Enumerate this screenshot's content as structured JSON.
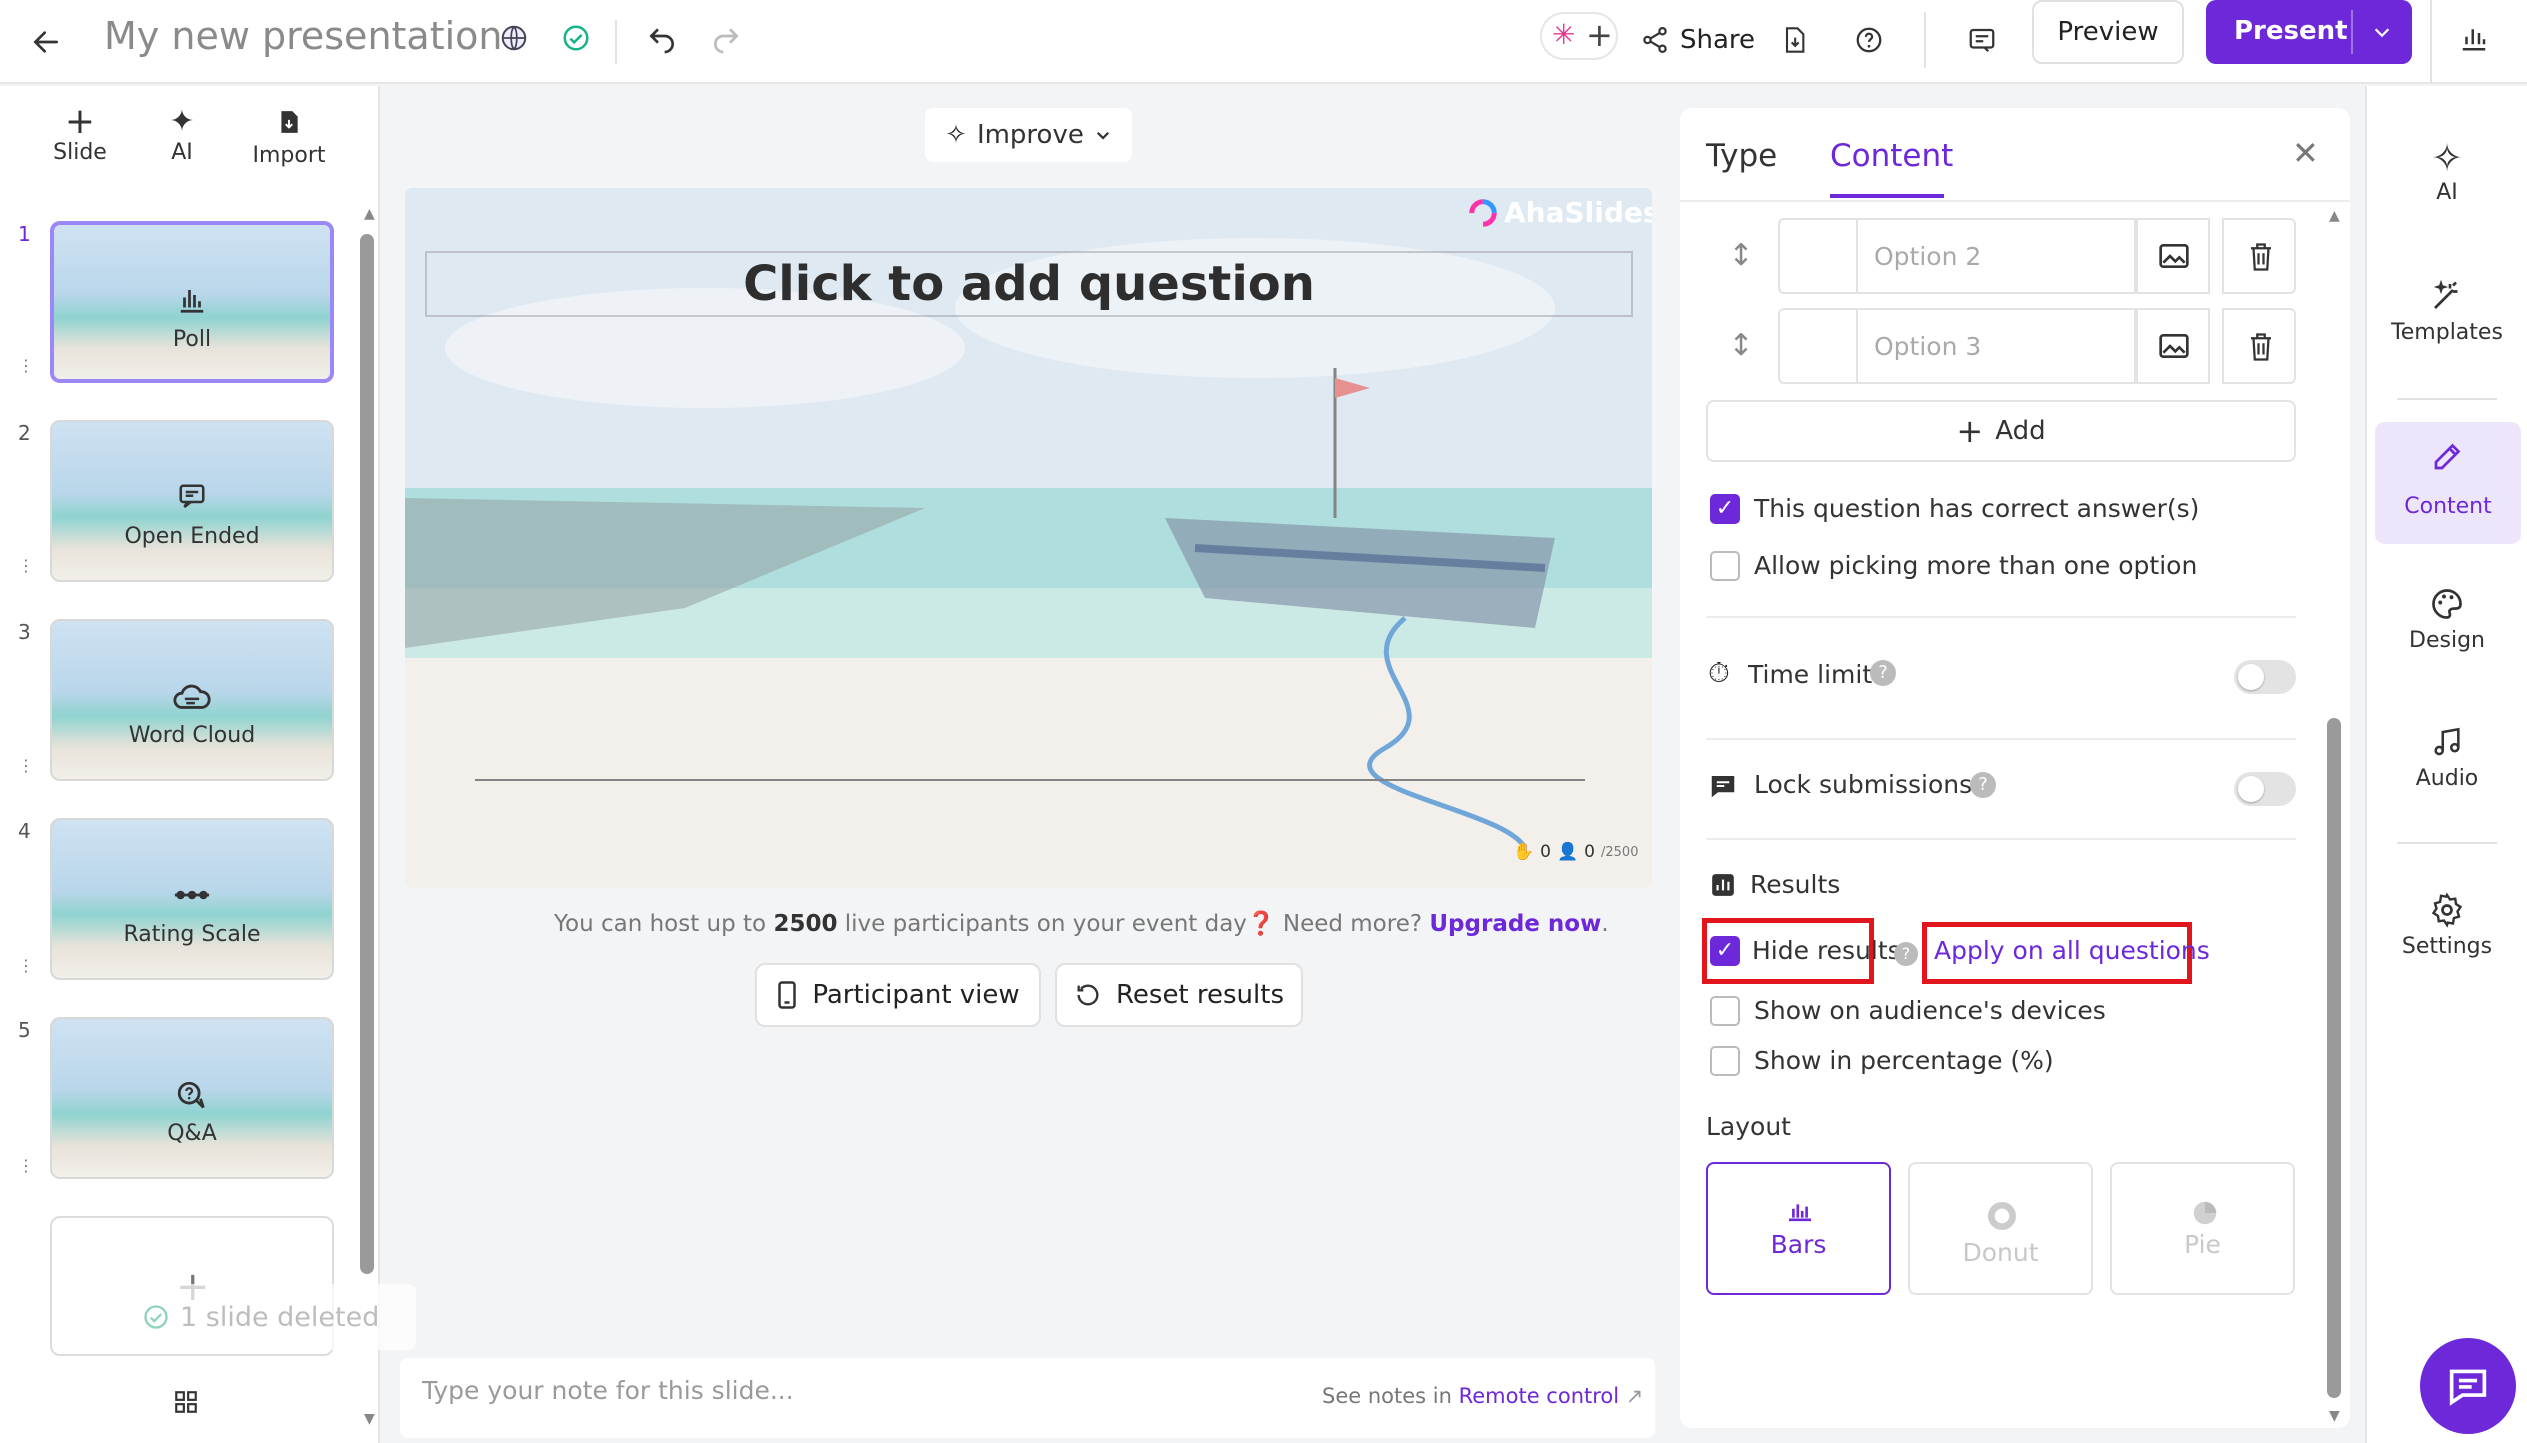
{
  "topbar": {
    "title": "My new presentation",
    "share_label": "Share",
    "preview_label": "Preview",
    "present_label": "Present"
  },
  "left_tools": [
    {
      "label": "Slide",
      "icon": "plus-icon"
    },
    {
      "label": "AI",
      "icon": "sparkle-icon"
    },
    {
      "label": "Import",
      "icon": "file-import-icon"
    }
  ],
  "slides": [
    {
      "num": "1",
      "label": "Poll",
      "icon": "bar-chart-icon",
      "selected": true
    },
    {
      "num": "2",
      "label": "Open Ended",
      "icon": "chat-icon"
    },
    {
      "num": "3",
      "label": "Word Cloud",
      "icon": "cloud-icon"
    },
    {
      "num": "4",
      "label": "Rating Scale",
      "icon": "scale-icon"
    },
    {
      "num": "5",
      "label": "Q&A",
      "icon": "qa-icon"
    }
  ],
  "toast": "1 slide deleted",
  "improve_label": "Improve",
  "canvas": {
    "question_placeholder": "Click to add question",
    "brand": "AhaSlides",
    "counter_hands": "0",
    "counter_people": "0",
    "counter_max": "/2500"
  },
  "upgrade": {
    "text_pre": "You can host up to ",
    "count": "2500",
    "text_mid": " live participants on your event day",
    "need_more": "Need more?",
    "link": "Upgrade now",
    "dot": "."
  },
  "participant_view_label": "Participant view",
  "reset_results_label": "Reset results",
  "notes": {
    "placeholder": "Type your note for this slide...",
    "see_notes": "See notes in ",
    "remote_link": "Remote control"
  },
  "panel": {
    "tab_type": "Type",
    "tab_content": "Content",
    "options": [
      {
        "placeholder": "Option 2"
      },
      {
        "placeholder": "Option 3"
      }
    ],
    "add_label": "Add",
    "correct_answer_label": "This question has correct answer(s)",
    "correct_answer_checked": true,
    "multi_pick_label": "Allow picking more than one option",
    "time_limit_label": "Time limit",
    "lock_submissions_label": "Lock submissions",
    "results_heading": "Results",
    "hide_results_label": "Hide results",
    "apply_all_label": "Apply on all questions",
    "show_devices_label": "Show on audience's devices",
    "show_percentage_label": "Show in percentage (%)",
    "layout_heading": "Layout",
    "layouts": [
      {
        "label": "Bars",
        "selected": true
      },
      {
        "label": "Donut"
      },
      {
        "label": "Pie"
      }
    ]
  },
  "sidebar": [
    {
      "label": "AI",
      "icon": "sparkle-icon"
    },
    {
      "label": "Templates",
      "icon": "magic-wand-icon"
    },
    {
      "label": "Content",
      "icon": "pencil-icon",
      "selected": true
    },
    {
      "label": "Design",
      "icon": "palette-icon"
    },
    {
      "label": "Audio",
      "icon": "music-note-icon"
    },
    {
      "label": "Settings",
      "icon": "gear-icon"
    }
  ],
  "colors": {
    "accent": "#6d28d9",
    "highlight": "#e0161c"
  }
}
